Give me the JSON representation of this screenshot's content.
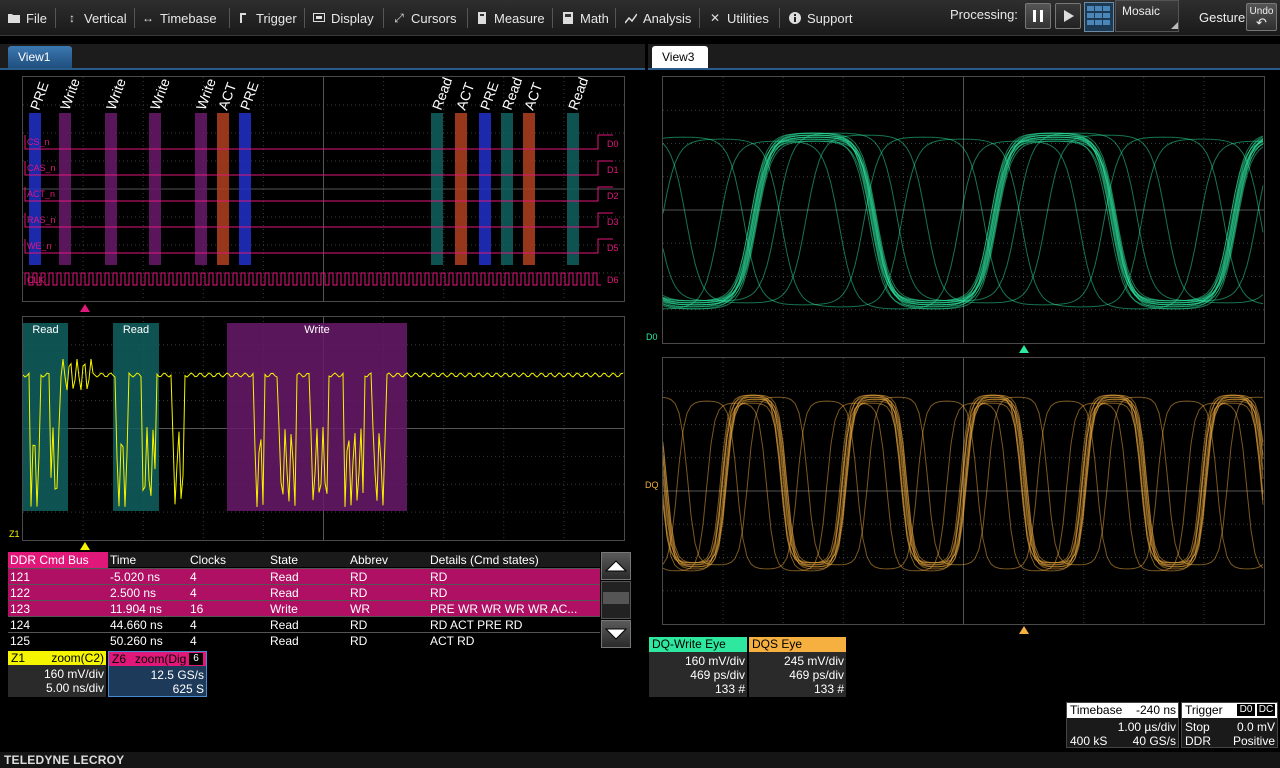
{
  "menu": {
    "items": [
      {
        "label": "File",
        "icon": "folder-icon"
      },
      {
        "label": "Vertical",
        "icon": "vertical-arrows-icon"
      },
      {
        "label": "Timebase",
        "icon": "horizontal-arrows-icon"
      },
      {
        "label": "Trigger",
        "icon": "trigger-icon"
      },
      {
        "label": "Display",
        "icon": "display-icon"
      },
      {
        "label": "Cursors",
        "icon": "cursor-icon"
      },
      {
        "label": "Measure",
        "icon": "measure-icon"
      },
      {
        "label": "Math",
        "icon": "calculator-icon"
      },
      {
        "label": "Analysis",
        "icon": "analysis-chart-icon"
      },
      {
        "label": "Utilities",
        "icon": "tools-icon"
      },
      {
        "label": "Support",
        "icon": "info-icon"
      }
    ],
    "processing_label": "Processing:",
    "layout_label": "Mosaic",
    "gesture_label": "Gesture",
    "undo_label": "Undo"
  },
  "views": {
    "left": "View1",
    "right": "View3"
  },
  "protocol": {
    "commands": [
      "PRE",
      "Write",
      "Write",
      "Write",
      "Write",
      "ACT",
      "PRE",
      "Read",
      "ACT",
      "PRE",
      "Read",
      "ACT",
      "Read"
    ],
    "signals": [
      "CS_n",
      "CAS_n",
      "ACT_n",
      "RAS_n",
      "WE_n",
      "CLK"
    ],
    "digital_channels": [
      "D0",
      "D1",
      "D2",
      "D3",
      "D5",
      "D6"
    ]
  },
  "zoom_trace": {
    "regions": [
      "Read",
      "Read",
      "Write"
    ],
    "label": "Z1"
  },
  "eye_labels": {
    "top": "D0",
    "bottom": "DQ"
  },
  "table": {
    "headers": [
      "DDR Cmd Bus",
      "Time",
      "Clocks",
      "State",
      "Abbrev",
      "Details (Cmd states)"
    ],
    "rows": [
      [
        "121",
        "-5.020 ns",
        "4",
        "Read",
        "RD",
        "RD"
      ],
      [
        "122",
        "2.500 ns",
        "4",
        "Read",
        "RD",
        "RD"
      ],
      [
        "123",
        "11.904 ns",
        "16",
        "Write",
        "WR",
        "PRE WR WR WR WR AC..."
      ],
      [
        "124",
        "44.660 ns",
        "4",
        "Read",
        "RD",
        "RD ACT PRE RD"
      ],
      [
        "125",
        "50.260 ns",
        "4",
        "Read",
        "RD",
        "ACT RD"
      ]
    ]
  },
  "descriptors": {
    "z1": {
      "name": "Z1",
      "source": "zoom(C2)",
      "v1": "160 mV/div",
      "v2": "5.00 ns/div",
      "color": "#f5f500"
    },
    "z6": {
      "name": "Z6",
      "source": "zoom(Dig",
      "badge": "6",
      "v1": "12.5 GS/s",
      "v2": "625 S",
      "color": "#e0187a"
    },
    "dqw": {
      "name": "DQ-Write Eye",
      "v1": "160 mV/div",
      "v2": "469 ps/div",
      "v3": "133 #",
      "color": "#2ee8a0"
    },
    "dqs": {
      "name": "DQS Eye",
      "v1": "245 mV/div",
      "v2": "469 ps/div",
      "v3": "133 #",
      "color": "#f5b040"
    }
  },
  "timebase": {
    "label": "Timebase",
    "offset": "-240 ns",
    "div": "1.00 µs/div",
    "samples": "400 kS",
    "rate": "40 GS/s"
  },
  "trigger": {
    "label": "Trigger",
    "badge1": "D0",
    "badge2": "DC",
    "mode": "Stop",
    "level": "0.0 mV",
    "type": "DDR",
    "slope": "Positive"
  },
  "brand": "TELEDYNE LECROY"
}
